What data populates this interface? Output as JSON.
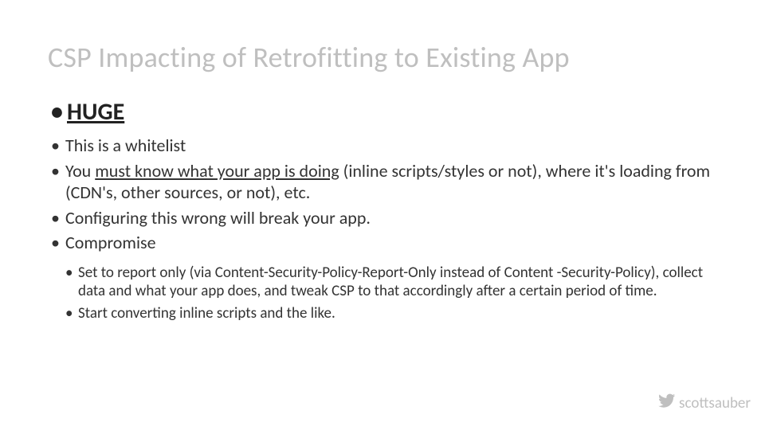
{
  "title": "CSP Impacting of Retrofitting to Existing App",
  "bullet_main": "HUGE",
  "bullets2": {
    "b0": "This is a whitelist",
    "b1_pre": "You ",
    "b1_u": "must know what your app is doing",
    "b1_post": " (inline scripts/styles or not), where it's loading from (CDN's, other sources, or not), etc.",
    "b2": "Configuring this wrong will break your app.",
    "b3": "Compromise"
  },
  "bullets3": {
    "b0": "Set to report only (via Content-Security-Policy-Report-Only instead of Content -Security-Policy), collect data and what your app does, and tweak CSP to that accordingly after a certain period of time.",
    "b1": "Start converting inline scripts and the like."
  },
  "footer_handle": "scottsauber"
}
